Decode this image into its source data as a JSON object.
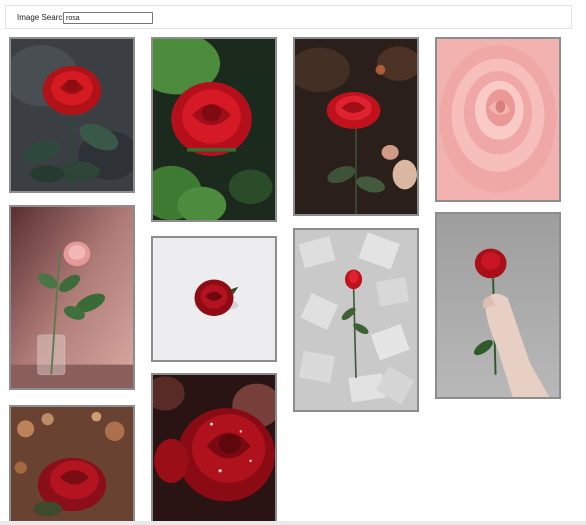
{
  "search": {
    "label": "Image Search",
    "value": "rosa"
  },
  "photo_icons": [
    "red-rose-dark-leaves",
    "red-rose-green-foliage",
    "red-rose-dark-garden",
    "pink-rose-closeup",
    "pink-rose-in-glass-vase",
    "red-rose-on-white",
    "red-rose-on-book-pages",
    "hand-holding-red-rose",
    "red-rose-bokeh-lights",
    "red-rose-water-drops"
  ],
  "colors": {
    "rose_red": "#c0121c",
    "rose_pink": "#f0a8a8",
    "photo_border": "#8d8d8d"
  }
}
